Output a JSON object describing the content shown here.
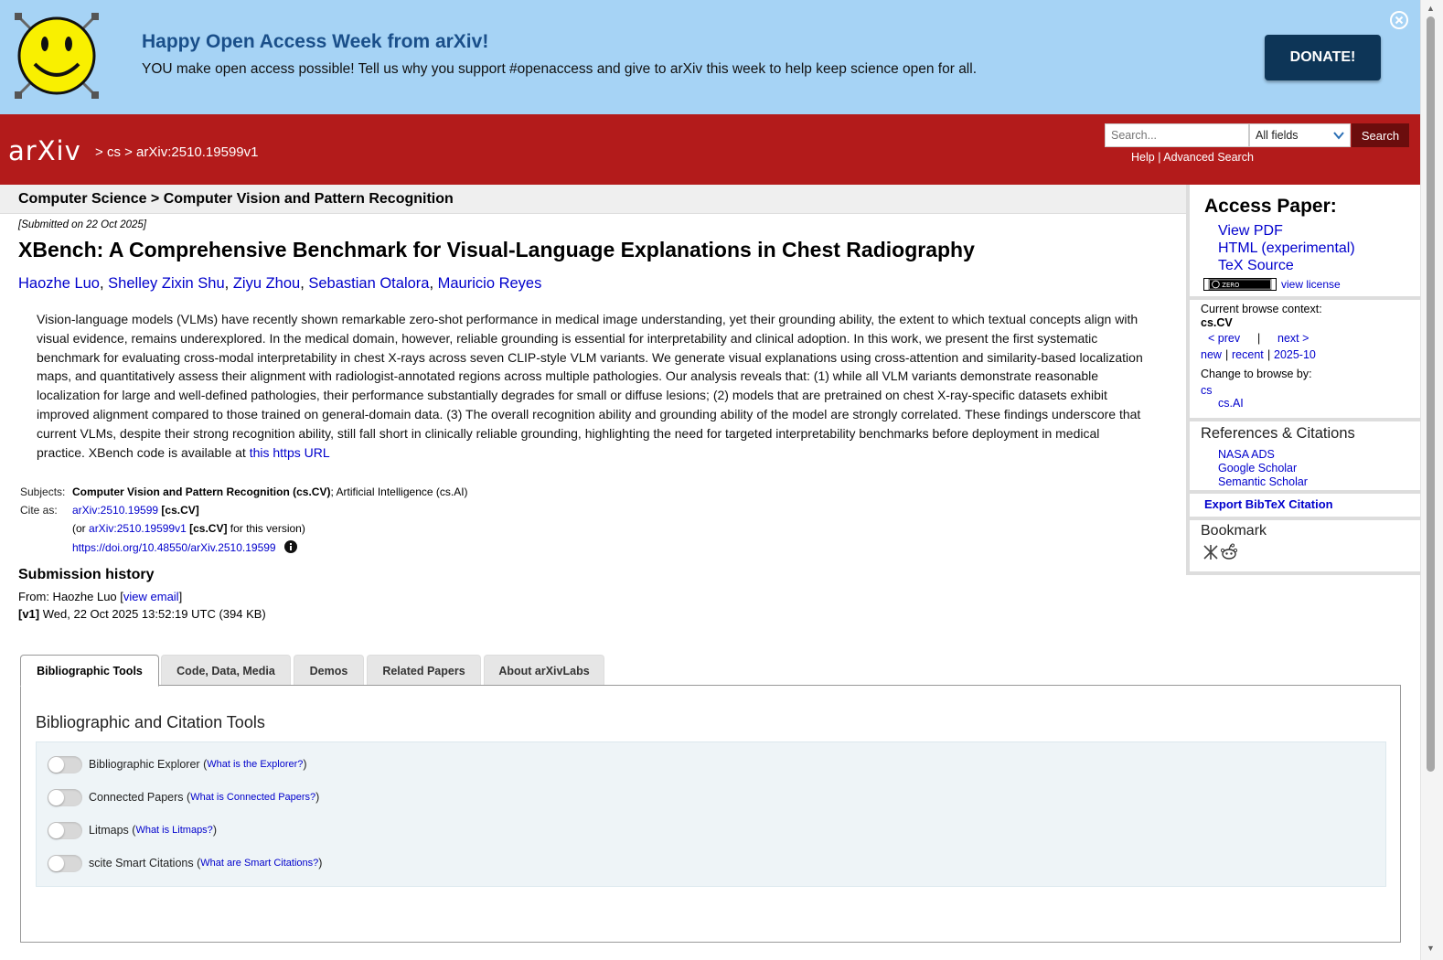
{
  "banner": {
    "title": "Happy Open Access Week from arXiv!",
    "text": "YOU make open access possible! Tell us why you support #openaccess and give to arXiv this week to help keep science open for all.",
    "donate_label": "DONATE!"
  },
  "header": {
    "logo_text": "arXiv",
    "breadcrumb": {
      "sep1": ">",
      "category": "cs",
      "sep2": ">",
      "id": "arXiv:2510.19599v1"
    },
    "search_placeholder": "Search...",
    "search_field": "All fields",
    "search_button": "Search",
    "help_label": "Help",
    "link_sep": "|",
    "advanced_label": "Advanced Search"
  },
  "subheader": "Computer Science > Computer Vision and Pattern Recognition",
  "paper": {
    "submitted": "[Submitted on 22 Oct 2025]",
    "title": "XBench: A Comprehensive Benchmark for Visual-Language Explanations in Chest Radiography",
    "authors": [
      "Haozhe Luo",
      "Shelley Zixin Shu",
      "Ziyu Zhou",
      "Sebastian Otalora",
      "Mauricio Reyes"
    ],
    "author_sep": ",",
    "abstract": "Vision-language models (VLMs) have recently shown remarkable zero-shot performance in medical image understanding, yet their grounding ability, the extent to which textual concepts align with visual evidence, remains underexplored. In the medical domain, however, reliable grounding is essential for interpretability and clinical adoption. In this work, we present the first systematic benchmark for evaluating cross-modal interpretability in chest X-rays across seven CLIP-style VLM variants. We generate visual explanations using cross-attention and similarity-based localization maps, and quantitatively assess their alignment with radiologist-annotated regions across multiple pathologies. Our analysis reveals that: (1) while all VLM variants demonstrate reasonable localization for large and well-defined pathologies, their performance substantially degrades for small or diffuse lesions; (2) models that are pretrained on chest X-ray-specific datasets exhibit improved alignment compared to those trained on general-domain data. (3) The overall recognition ability and grounding ability of the model are strongly correlated. These findings underscore that current VLMs, despite their strong recognition ability, still fall short in clinically reliable grounding, highlighting the need for targeted interpretability benchmarks before deployment in medical practice. XBench code is available at",
    "abstract_link": "this https URL"
  },
  "meta": {
    "subjects_label": "Subjects:",
    "subjects_primary": "Computer Vision and Pattern Recognition (cs.CV)",
    "subjects_rest": "; Artificial Intelligence (cs.AI)",
    "cite_label": "Cite as:",
    "cite_id": "arXiv:2510.19599",
    "cite_cat": "[cs.CV]",
    "cite_version_prefix": "(or",
    "cite_version_id": "arXiv:2510.19599v1",
    "cite_version_cat": "[cs.CV]",
    "cite_version_suffix": "for this version)",
    "doi": "https://doi.org/10.48550/arXiv.2510.19599"
  },
  "history": {
    "title": "Submission history",
    "from_prefix": "From: Haozhe Luo [",
    "view_email": "view email",
    "from_suffix": "]",
    "v1_label": "[v1]",
    "v1_text": "Wed, 22 Oct 2025 13:52:19 UTC (394 KB)"
  },
  "tabs": [
    "Bibliographic Tools",
    "Code, Data, Media",
    "Demos",
    "Related Papers",
    "About arXivLabs"
  ],
  "tools": {
    "title": "Bibliographic and Citation Tools",
    "items": [
      {
        "label": "Bibliographic Explorer",
        "help": "What is the Explorer?"
      },
      {
        "label": "Connected Papers",
        "help": "What is Connected Papers?"
      },
      {
        "label": "Litmaps",
        "help": "What is Litmaps?"
      },
      {
        "label": "scite Smart Citations",
        "help": "What are Smart Citations?"
      }
    ],
    "paren_open": "(",
    "paren_close": ")"
  },
  "sidebar": {
    "access_title": "Access Paper:",
    "view_pdf": "View PDF",
    "html": "HTML (experimental)",
    "tex": "TeX Source",
    "cc_text": "ZERO",
    "view_license": "view license",
    "context_label": "Current browse context:",
    "context_value": "cs.CV",
    "prev": "< prev",
    "pipe": "|",
    "next": "next >",
    "new": "new",
    "recent": "recent",
    "month": "2025-10",
    "change_label": "Change to browse by:",
    "browse_cs": "cs",
    "browse_csai": "cs.AI",
    "refs_title": "References & Citations",
    "nasa": "NASA ADS",
    "google": "Google Scholar",
    "semantic": "Semantic Scholar",
    "export": "Export BibTeX Citation",
    "bookmark_title": "Bookmark"
  },
  "colors": {
    "banner_bg": "#a6d3f5",
    "header_red": "#b31b1b",
    "link_blue": "#0000cc",
    "donate_bg": "#0d3557"
  }
}
